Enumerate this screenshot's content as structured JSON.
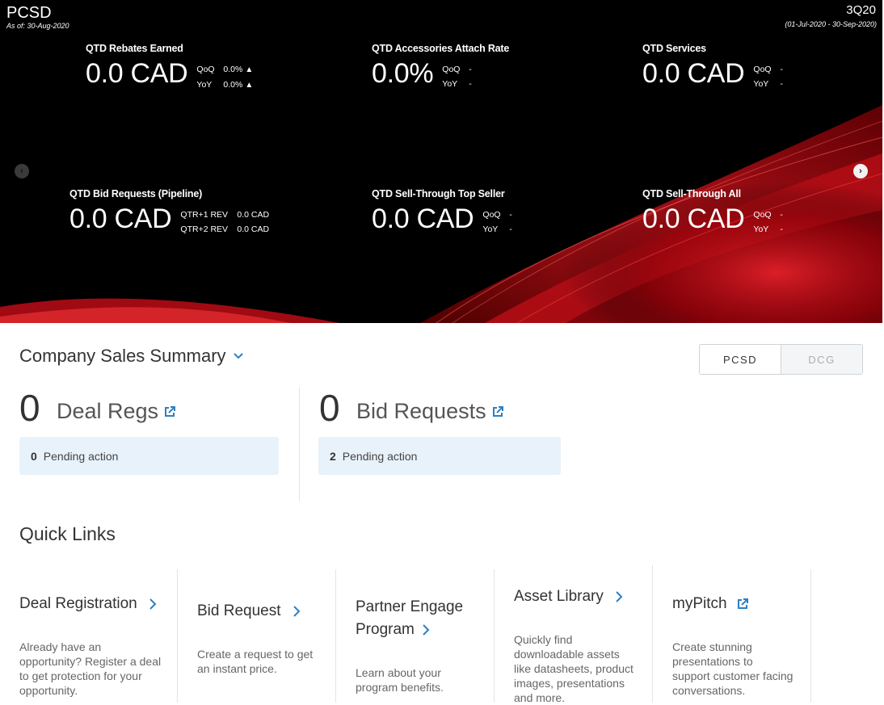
{
  "hero": {
    "brand": "PCSD",
    "as_of": "As of: 30-Aug-2020",
    "quarter": "3Q20",
    "date_range": "(01-Jul-2020  -  30-Sep-2020)",
    "kpis": [
      {
        "title": "QTD Rebates Earned",
        "value": "0.0 CAD",
        "rows": [
          {
            "label": "QoQ",
            "val": "0.0%",
            "arrow": "▲"
          },
          {
            "label": "YoY",
            "val": "0.0%",
            "arrow": "▲"
          }
        ]
      },
      {
        "title": "QTD Accessories Attach Rate",
        "value": "0.0%",
        "rows": [
          {
            "label": "QoQ",
            "val": "-"
          },
          {
            "label": "YoY",
            "val": "-"
          }
        ]
      },
      {
        "title": "QTD Services",
        "value": "0.0 CAD",
        "rows": [
          {
            "label": "QoQ",
            "val": "-"
          },
          {
            "label": "YoY",
            "val": "-"
          }
        ]
      },
      {
        "title": "QTD Bid Requests (Pipeline)",
        "value": "0.0 CAD",
        "rows": [
          {
            "label": "QTR+1 REV",
            "val": "0.0 CAD"
          },
          {
            "label": "QTR+2 REV",
            "val": "0.0 CAD"
          }
        ]
      },
      {
        "title": "QTD Sell-Through Top Seller",
        "value": "0.0 CAD",
        "rows": [
          {
            "label": "QoQ",
            "val": "-"
          },
          {
            "label": "YoY",
            "val": "-"
          }
        ]
      },
      {
        "title": "QTD Sell-Through All",
        "value": "0.0 CAD",
        "rows": [
          {
            "label": "QoQ",
            "val": "-"
          },
          {
            "label": "YoY",
            "val": "-"
          }
        ]
      }
    ],
    "prev_icon": "chevron-left-icon",
    "next_icon": "chevron-right-icon",
    "prev_glyph": "‹",
    "next_glyph": "›"
  },
  "summary": {
    "title": "Company Sales Summary",
    "segments": [
      {
        "label": "PCSD",
        "active": true
      },
      {
        "label": "DCG",
        "active": false
      }
    ],
    "deal_regs": {
      "count": "0",
      "label": "Deal Regs",
      "pending_count": "0",
      "pending_label": "Pending action"
    },
    "bid_requests": {
      "count": "0",
      "label": "Bid Requests",
      "pending_count": "2",
      "pending_label": "Pending action"
    }
  },
  "quick_links": {
    "title": "Quick Links",
    "items": [
      {
        "title": "Deal Registration",
        "icon": "chevron-right-icon",
        "desc": "Already have an opportunity? Register a deal to get protection for your opportunity."
      },
      {
        "title": "Bid Request",
        "icon": "chevron-right-icon",
        "desc": "Create a request to get an instant price."
      },
      {
        "title_line1": "Partner Engage",
        "title_line2": "Program",
        "icon": "chevron-right-icon",
        "desc": "Learn about your program benefits."
      },
      {
        "title": "Asset Library",
        "icon": "chevron-right-icon",
        "desc": "Quickly find downloadable assets like datasheets, product images, presentations and more."
      },
      {
        "title": "myPitch",
        "icon": "external-link-icon",
        "desc": "Create stunning presentations to support customer facing conversations."
      }
    ]
  },
  "colors": {
    "accent_blue": "#2f7fc1",
    "pending_bg": "#e8f2fa",
    "hero_red": "#d0141c"
  }
}
